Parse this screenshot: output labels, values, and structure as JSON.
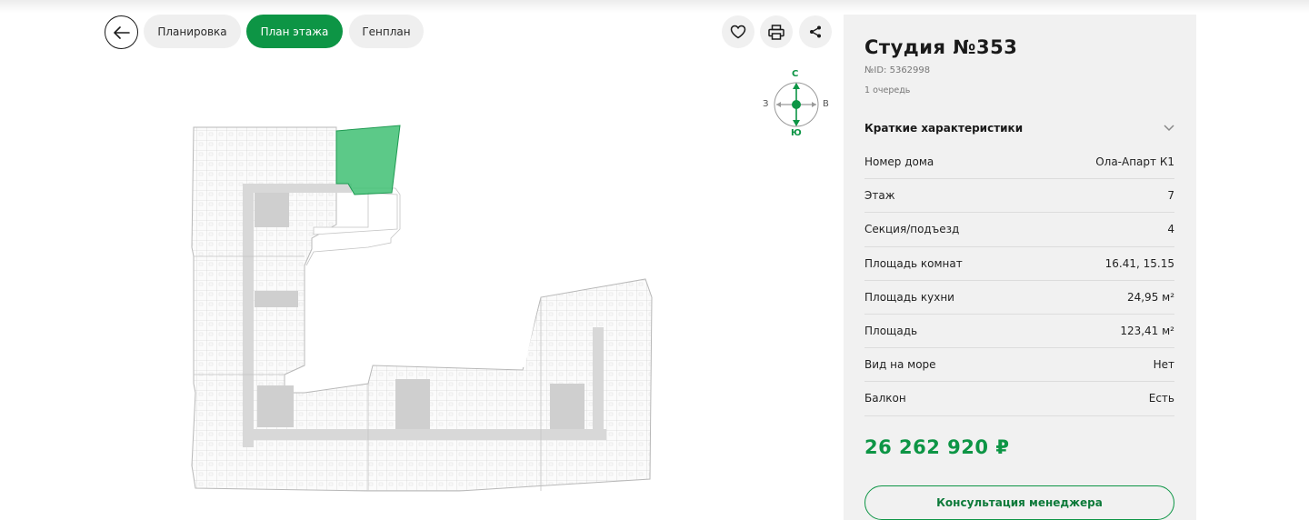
{
  "nav": {
    "back_label": "",
    "tabs": [
      {
        "label": "Планировка",
        "active": false
      },
      {
        "label": "План этажа",
        "active": true
      },
      {
        "label": "Генплан",
        "active": false
      }
    ]
  },
  "actions": {
    "favorite_icon": "heart-icon",
    "print_icon": "printer-icon",
    "share_icon": "share-icon"
  },
  "compass": {
    "north": "С",
    "south": "Ю",
    "west": "З",
    "east": "В"
  },
  "apartment": {
    "title": "Студия №353",
    "id_text": "№ID: 5362998",
    "queue": "1 очередь",
    "section_title": "Краткие характеристики",
    "specs": [
      {
        "label": "Номер дома",
        "value": "Ола-Апарт К1"
      },
      {
        "label": "Этаж",
        "value": "7"
      },
      {
        "label": "Секция/подъезд",
        "value": "4"
      },
      {
        "label": "Площадь комнат",
        "value": "16.41, 15.15"
      },
      {
        "label": "Площадь кухни",
        "value": "24,95 м²"
      },
      {
        "label": "Площадь",
        "value": "123,41 м²"
      },
      {
        "label": "Вид на море",
        "value": "Нет"
      },
      {
        "label": "Балкон",
        "value": "Есть"
      }
    ],
    "price": "26 262 920 ₽",
    "cta_label": "Консультация менеджера"
  },
  "colors": {
    "accent": "#0d9545",
    "panel_bg": "#f1f1f1",
    "highlight_unit": "#3fbf73"
  }
}
